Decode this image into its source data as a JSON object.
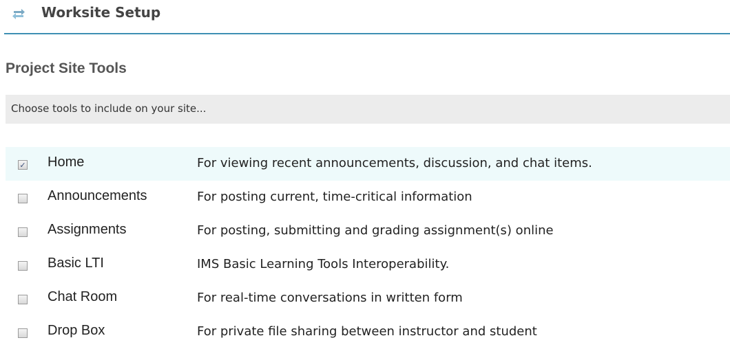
{
  "header": {
    "icon": "refresh-arrows-icon",
    "title": "Worksite Setup",
    "accent_color": "#3d8fb3"
  },
  "page": {
    "title": "Project Site Tools"
  },
  "instruction": {
    "text": "Choose tools to include on your site..."
  },
  "tools": [
    {
      "name": "Home",
      "description": "For viewing recent announcements, discussion, and chat items.",
      "checked": true
    },
    {
      "name": "Announcements",
      "description": "For posting current, time-critical information",
      "checked": false
    },
    {
      "name": "Assignments",
      "description": "For posting, submitting and grading assignment(s) online",
      "checked": false
    },
    {
      "name": "Basic LTI",
      "description": "IMS Basic Learning Tools Interoperability.",
      "checked": false
    },
    {
      "name": "Chat Room",
      "description": "For real-time conversations in written form",
      "checked": false
    },
    {
      "name": "Drop Box",
      "description": "For private file sharing between instructor and student",
      "checked": false
    }
  ]
}
